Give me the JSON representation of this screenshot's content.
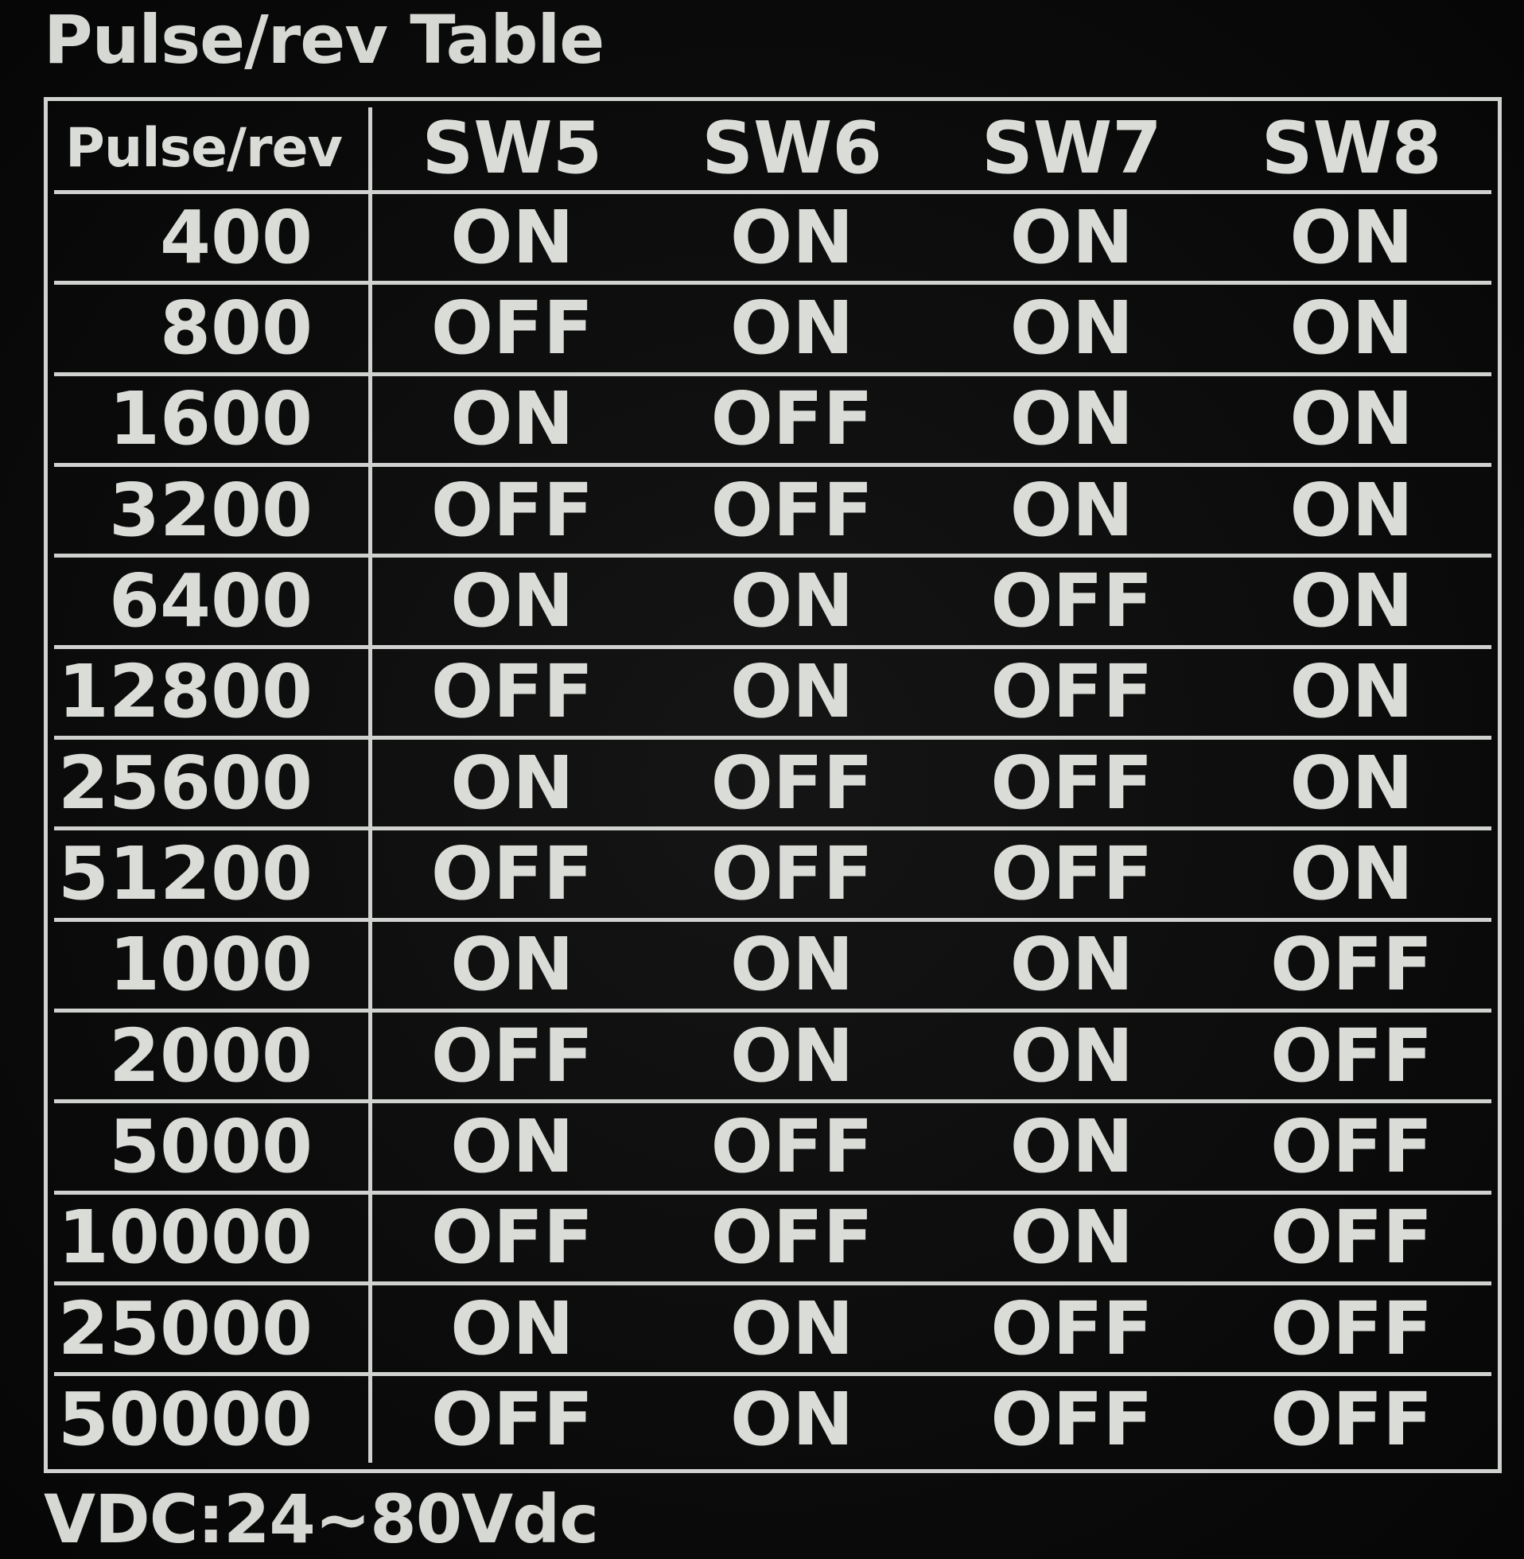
{
  "title": "Pulse/rev Table",
  "footer": "VDC:24~80Vdc",
  "headers": [
    "Pulse/rev",
    "SW5",
    "SW6",
    "SW7",
    "SW8"
  ],
  "rows": [
    {
      "pulse": "400",
      "sw5": "ON",
      "sw6": "ON",
      "sw7": "ON",
      "sw8": "ON"
    },
    {
      "pulse": "800",
      "sw5": "OFF",
      "sw6": "ON",
      "sw7": "ON",
      "sw8": "ON"
    },
    {
      "pulse": "1600",
      "sw5": "ON",
      "sw6": "OFF",
      "sw7": "ON",
      "sw8": "ON"
    },
    {
      "pulse": "3200",
      "sw5": "OFF",
      "sw6": "OFF",
      "sw7": "ON",
      "sw8": "ON"
    },
    {
      "pulse": "6400",
      "sw5": "ON",
      "sw6": "ON",
      "sw7": "OFF",
      "sw8": "ON"
    },
    {
      "pulse": "12800",
      "sw5": "OFF",
      "sw6": "ON",
      "sw7": "OFF",
      "sw8": "ON"
    },
    {
      "pulse": "25600",
      "sw5": "ON",
      "sw6": "OFF",
      "sw7": "OFF",
      "sw8": "ON"
    },
    {
      "pulse": "51200",
      "sw5": "OFF",
      "sw6": "OFF",
      "sw7": "OFF",
      "sw8": "ON"
    },
    {
      "pulse": "1000",
      "sw5": "ON",
      "sw6": "ON",
      "sw7": "ON",
      "sw8": "OFF"
    },
    {
      "pulse": "2000",
      "sw5": "OFF",
      "sw6": "ON",
      "sw7": "ON",
      "sw8": "OFF"
    },
    {
      "pulse": "5000",
      "sw5": "ON",
      "sw6": "OFF",
      "sw7": "ON",
      "sw8": "OFF"
    },
    {
      "pulse": "10000",
      "sw5": "OFF",
      "sw6": "OFF",
      "sw7": "ON",
      "sw8": "OFF"
    },
    {
      "pulse": "25000",
      "sw5": "ON",
      "sw6": "ON",
      "sw7": "OFF",
      "sw8": "OFF"
    },
    {
      "pulse": "50000",
      "sw5": "OFF",
      "sw6": "ON",
      "sw7": "OFF",
      "sw8": "OFF"
    }
  ]
}
